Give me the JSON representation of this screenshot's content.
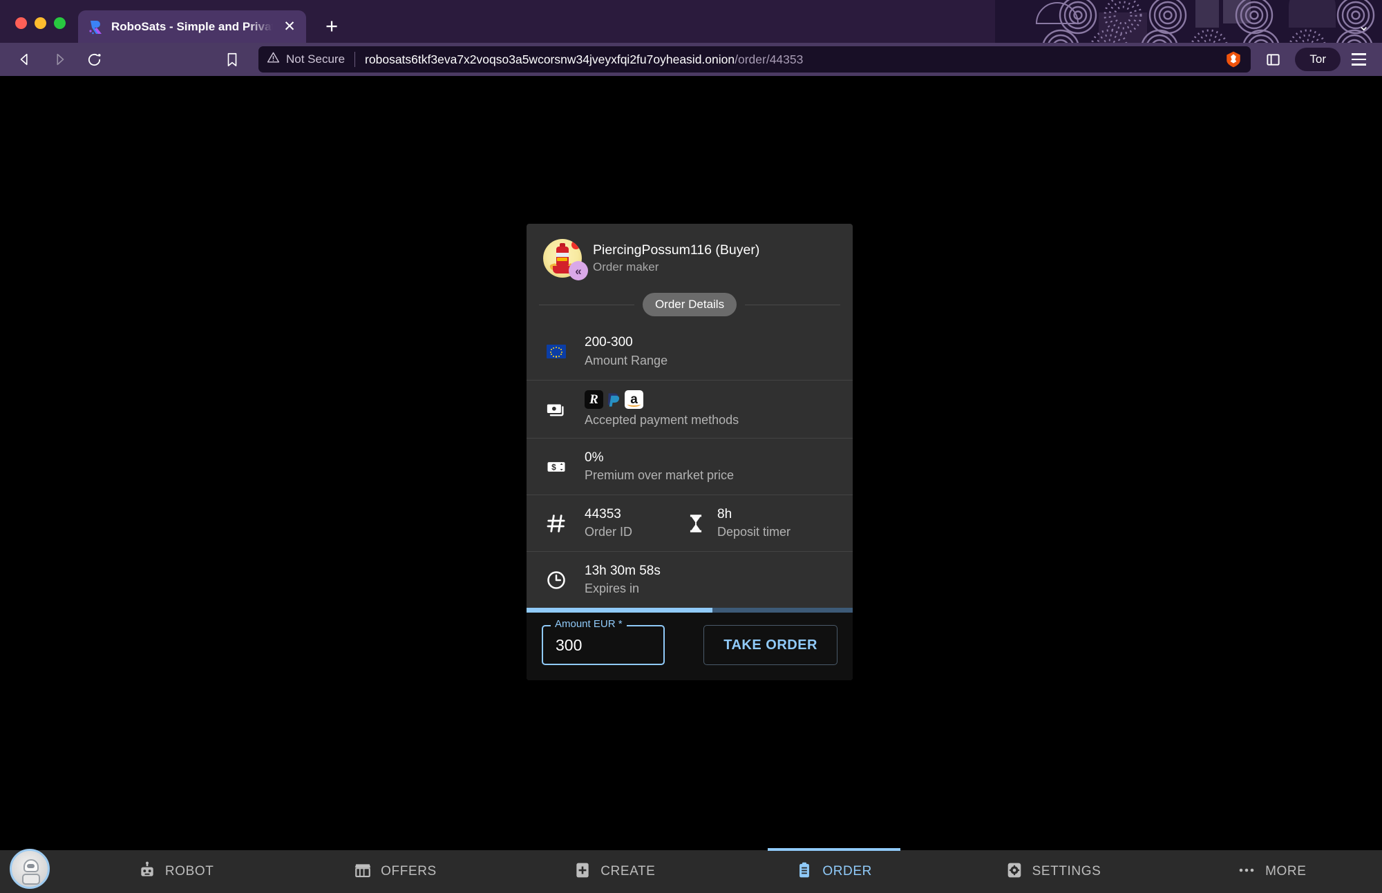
{
  "browser": {
    "traffic_lights": [
      "close",
      "minimize",
      "maximize"
    ],
    "tab": {
      "favicon": "robosats-favicon-icon",
      "title": "RoboSats - Simple and Private B",
      "close_icon": "close-icon"
    },
    "new_tab_label": "+",
    "tabstrip_chevron": "chevron-down-icon",
    "back_icon": "back-arrow-icon",
    "forward_icon": "forward-arrow-icon",
    "reload_icon": "reload-icon",
    "bookmark_icon": "bookmark-icon",
    "security": {
      "warning_icon": "warning-triangle-icon",
      "label": "Not Secure"
    },
    "url": {
      "host": "robosats6tkf3eva7x2voqso3a5wcorsnw34jveyxfqi2fu7oyheasid.onion",
      "path": "/order/44353"
    },
    "shields_icon": "brave-lion-icon",
    "sidebar_icon": "sidebar-panel-icon",
    "tor_badge": "Tor",
    "menu_icon": "hamburger-menu-icon"
  },
  "card": {
    "maker": {
      "avatar": "robot-avatar-icon",
      "badge_icon": "double-chevron-left-icon",
      "name": "PiercingPossum116 (Buyer)",
      "role": "Order maker"
    },
    "section_label": "Order Details",
    "rows": [
      {
        "icon": "eu-flag-icon",
        "value": "200-300",
        "label": "Amount Range"
      },
      {
        "icon": "banknotes-icon",
        "value": "",
        "label": "Accepted payment methods",
        "payment_methods": [
          "Revolut",
          "PayPal",
          "Amazon"
        ]
      },
      {
        "icon": "price-tag-dollar-icon",
        "value": "0%",
        "label": "Premium over market price"
      },
      {
        "icon": "hash-icon",
        "value": "44353",
        "label": "Order ID",
        "secondary": {
          "icon": "hourglass-icon",
          "value": "8h",
          "label": "Deposit timer"
        }
      },
      {
        "icon": "clock-icon",
        "value": "13h 30m 58s",
        "label": "Expires in"
      }
    ],
    "progress_percent": 57,
    "amount_input": {
      "legend": "Amount EUR *",
      "value": "300",
      "placeholder": "0"
    },
    "take_order_label": "TAKE ORDER"
  },
  "bottom_nav": {
    "avatar": "user-robot-avatar-icon",
    "items": [
      {
        "icon": "robot-icon",
        "label": "ROBOT",
        "active": false
      },
      {
        "icon": "storefront-icon",
        "label": "OFFERS",
        "active": false
      },
      {
        "icon": "plus-box-icon",
        "label": "CREATE",
        "active": false
      },
      {
        "icon": "clipboard-icon",
        "label": "ORDER",
        "active": true
      },
      {
        "icon": "gear-icon",
        "label": "SETTINGS",
        "active": false
      },
      {
        "icon": "ellipsis-icon",
        "label": "MORE",
        "active": false
      }
    ]
  },
  "colors": {
    "accent_blue": "#90caf9",
    "card_bg": "#303030",
    "page_bg": "#000000",
    "chrome_purple": "#4b3a63",
    "tabstrip_purple": "#2b1b3d"
  }
}
